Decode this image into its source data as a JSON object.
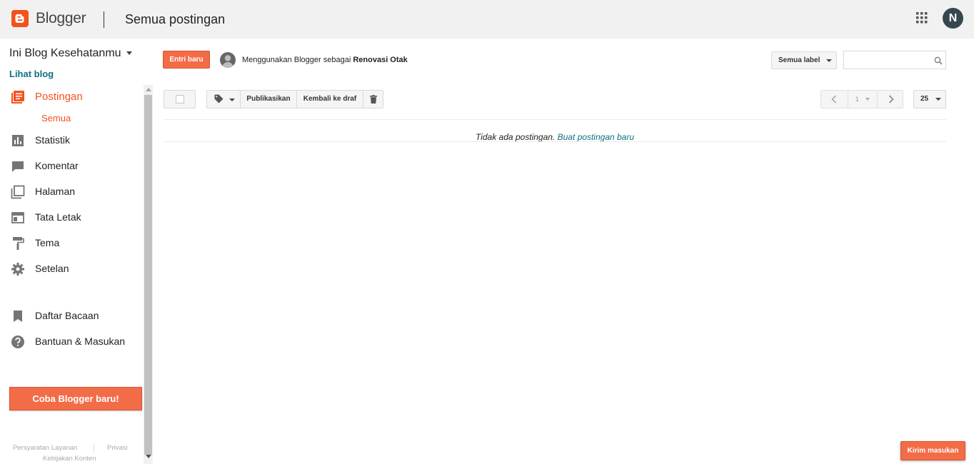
{
  "header": {
    "app_name": "Blogger",
    "page_title": "Semua postingan",
    "avatar_initial": "N",
    "brand_color": "#f4511e"
  },
  "sidebar": {
    "blog_name": "Ini Blog Kesehatanmu",
    "view_blog": "Lihat blog",
    "items": [
      {
        "label": "Postingan",
        "icon": "posts-icon",
        "active": true
      },
      {
        "label": "Statistik",
        "icon": "stats-icon"
      },
      {
        "label": "Komentar",
        "icon": "comment-icon"
      },
      {
        "label": "Halaman",
        "icon": "pages-icon"
      },
      {
        "label": "Tata Letak",
        "icon": "layout-icon"
      },
      {
        "label": "Tema",
        "icon": "theme-paint-roller-icon"
      },
      {
        "label": "Setelan",
        "icon": "settings-gear-icon"
      },
      {
        "label": "Daftar Bacaan",
        "icon": "bookmark-icon"
      },
      {
        "label": "Bantuan & Masukan",
        "icon": "help-icon"
      }
    ],
    "sub_item": "Semua",
    "try_new": "Coba Blogger baru!",
    "footer": {
      "terms": "Persyaratan Layanan",
      "privacy": "Privasi",
      "content_policy": "Kebijakan Konten"
    }
  },
  "main": {
    "new_post": "Entri baru",
    "user_prefix": "Menggunakan Blogger sebagai",
    "user_name": "Renovasi Otak",
    "label_filter": "Semua label",
    "search_placeholder": "",
    "toolbar": {
      "publish": "Publikasikan",
      "revert_draft": "Kembali ke draf"
    },
    "pager": {
      "page": "1",
      "per_page": "25"
    },
    "empty_message": "Tidak ada postingan.",
    "create_link": "Buat postingan baru"
  },
  "feedback_button": "Kirim masukan"
}
